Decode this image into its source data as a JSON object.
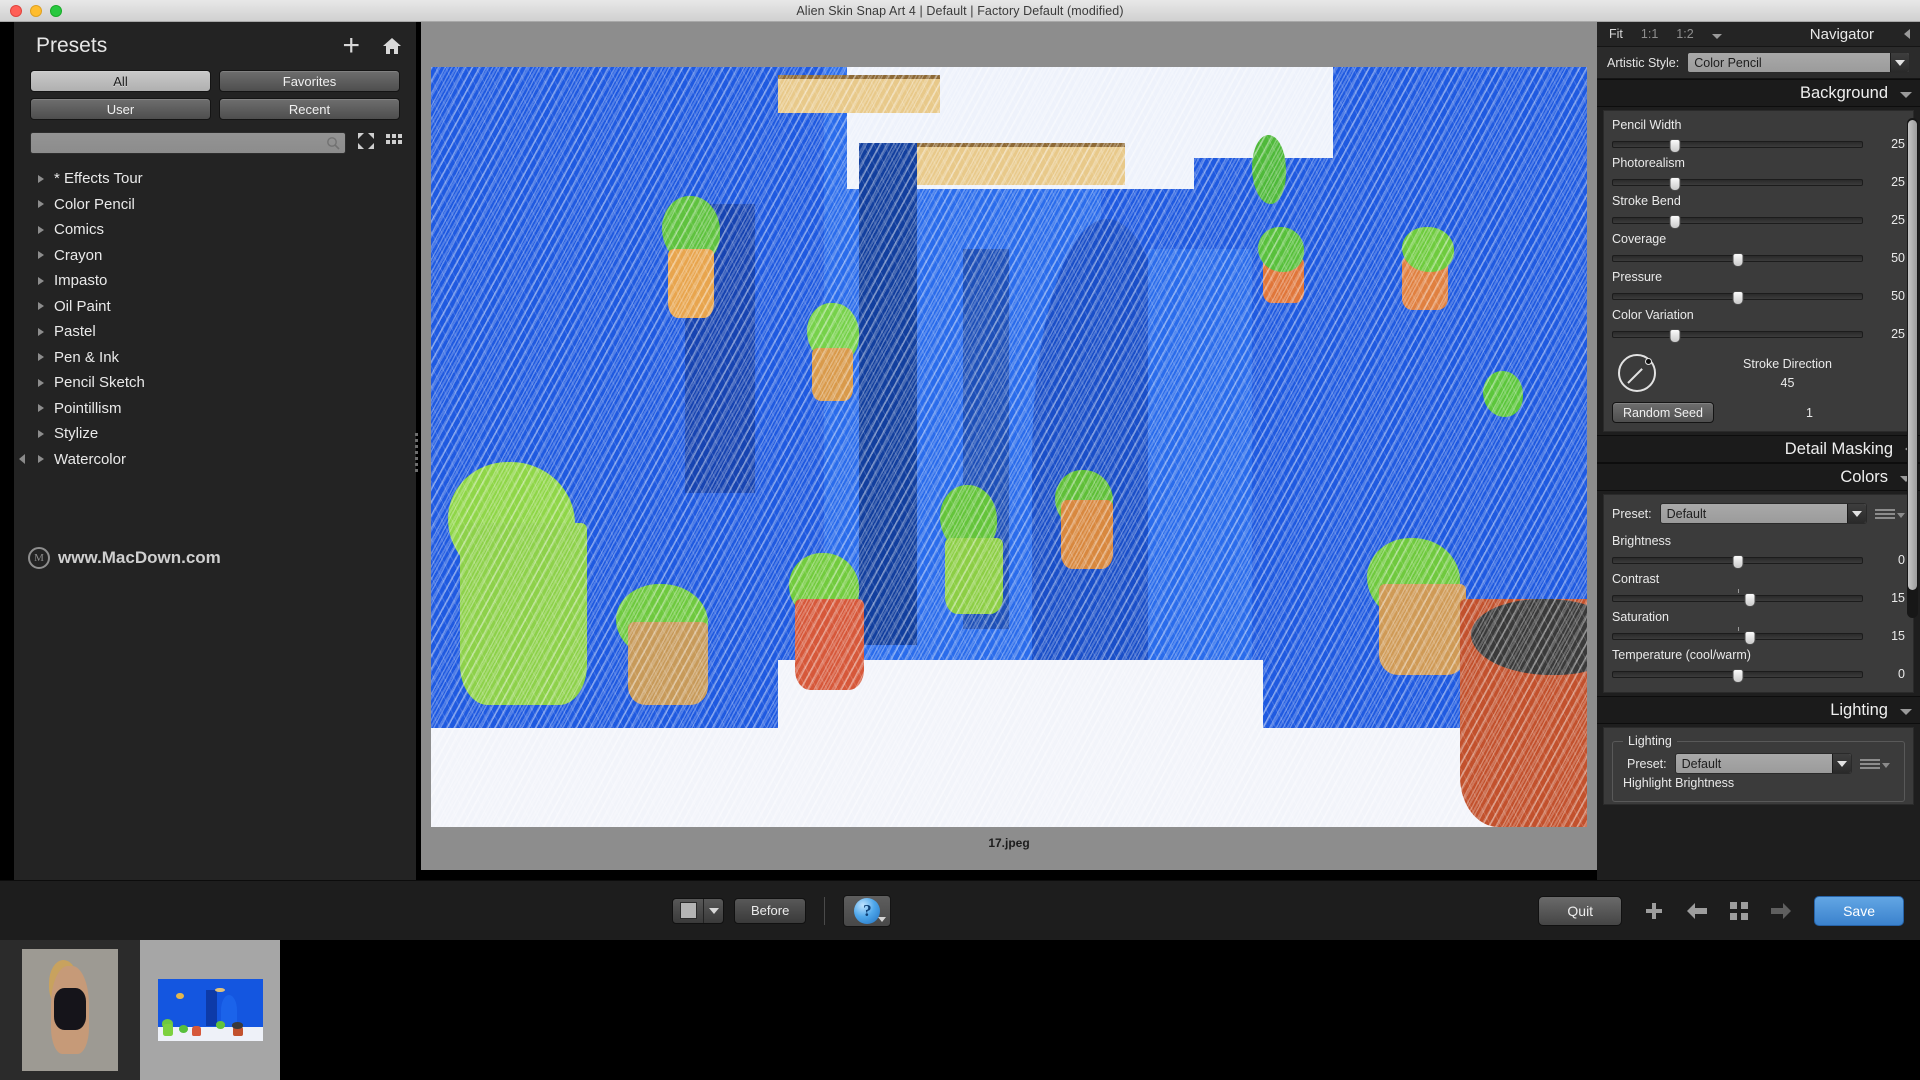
{
  "window": {
    "title": "Alien Skin Snap Art 4 | Default | Factory Default (modified)",
    "accent_blue": "#3b82cd"
  },
  "presets": {
    "title": "Presets",
    "add_icon": "plus-icon",
    "home_icon": "home-icon",
    "filters": [
      {
        "label": "All",
        "active": true
      },
      {
        "label": "Favorites",
        "active": false
      },
      {
        "label": "User",
        "active": false
      },
      {
        "label": "Recent",
        "active": false
      }
    ],
    "search": {
      "value": "",
      "placeholder": ""
    },
    "collapse_icon": "collapse-arrows-icon",
    "grid_icon": "grid-view-icon",
    "items": [
      {
        "label": "* Effects Tour"
      },
      {
        "label": "Color Pencil"
      },
      {
        "label": "Comics"
      },
      {
        "label": "Crayon"
      },
      {
        "label": "Impasto"
      },
      {
        "label": "Oil Paint"
      },
      {
        "label": "Pastel"
      },
      {
        "label": "Pen & Ink"
      },
      {
        "label": "Pencil Sketch"
      },
      {
        "label": "Pointillism"
      },
      {
        "label": "Stylize"
      },
      {
        "label": "Watercolor"
      }
    ],
    "watermark": {
      "logo": "M",
      "text": "www.MacDown.com"
    }
  },
  "canvas": {
    "filename": "17.jpeg"
  },
  "navigator": {
    "fit_label": "Fit",
    "zoom_1_1": "1:1",
    "zoom_1_2": "1:2",
    "title": "Navigator"
  },
  "artistic_style": {
    "label": "Artistic Style:",
    "value": "Color Pencil"
  },
  "background": {
    "title": "Background",
    "sliders": [
      {
        "label": "Pencil Width",
        "value": "25",
        "pct": 25
      },
      {
        "label": "Photorealism",
        "value": "25",
        "pct": 25
      },
      {
        "label": "Stroke Bend",
        "value": "25",
        "pct": 25
      },
      {
        "label": "Coverage",
        "value": "50",
        "pct": 50
      },
      {
        "label": "Pressure",
        "value": "50",
        "pct": 50
      },
      {
        "label": "Color Variation",
        "value": "25",
        "pct": 25
      }
    ],
    "stroke_direction": {
      "label": "Stroke Direction",
      "value": "45"
    },
    "random_seed": {
      "label": "Random Seed",
      "value": "1"
    }
  },
  "detail_masking": {
    "title": "Detail Masking"
  },
  "colors": {
    "title": "Colors",
    "preset_label": "Preset:",
    "preset_value": "Default",
    "sliders": [
      {
        "label": "Brightness",
        "value": "0",
        "pct": 50,
        "tick": null
      },
      {
        "label": "Contrast",
        "value": "15",
        "pct": 55,
        "tick": 50
      },
      {
        "label": "Saturation",
        "value": "15",
        "pct": 55,
        "tick": 50
      },
      {
        "label": "Temperature (cool/warm)",
        "value": "0",
        "pct": 50,
        "tick": null
      }
    ]
  },
  "lighting": {
    "title": "Lighting",
    "group_caption": "Lighting",
    "preset_label": "Preset:",
    "preset_value": "Default",
    "first_slider_label": "Highlight Brightness"
  },
  "toolbar": {
    "swatch_icon": "color-swatch-icon",
    "before_label": "Before",
    "help_glyph": "?",
    "quit_label": "Quit",
    "save_label": "Save",
    "add_icon": "plus-icon",
    "prev_icon": "arrow-left-icon",
    "grid_icon": "grid-icon",
    "next_icon": "arrow-right-icon"
  },
  "filmstrip": {
    "thumbnails": [
      {
        "name": "portrait-thumbnail",
        "selected": false
      },
      {
        "name": "courtyard-thumbnail",
        "selected": true
      }
    ]
  }
}
